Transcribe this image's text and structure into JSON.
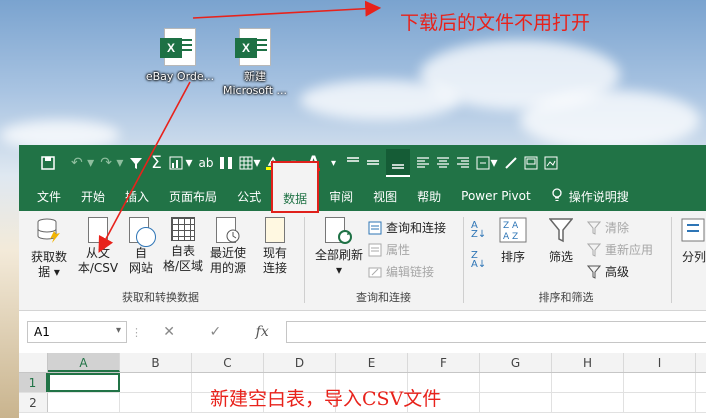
{
  "desktop": {
    "icons": [
      {
        "label": "eBay Orde...",
        "icon": "excel-file-icon",
        "badge": "X"
      },
      {
        "label": "新建",
        "label2": "Microsoft ...",
        "icon": "excel-file-icon",
        "badge": "X"
      }
    ]
  },
  "annotations": {
    "top": "下载后的文件不用打开",
    "bottom": "新建空白表，导入CSV文件",
    "color": "#e8221b"
  },
  "quick_access": {
    "icons": [
      "save-icon",
      "undo-icon",
      "redo-icon",
      "filter-icon",
      "autosum-icon",
      "chart-icon",
      "spelling-icon",
      "columns-icon",
      "table-icon",
      "fill-color-icon",
      "font-color-icon",
      "align-top-icon",
      "align-middle-icon",
      "align-bottom-icon",
      "align-left-icon",
      "align-center-icon",
      "align-right-icon",
      "merge-icon",
      "format-painter-icon",
      "view-icon",
      "view-icon-2"
    ],
    "spell_label": "ab",
    "font_color_label": "A"
  },
  "tabs": [
    "文件",
    "开始",
    "插入",
    "页面布局",
    "公式",
    "数据",
    "审阅",
    "视图",
    "帮助",
    "Power Pivot",
    "操作说明搜"
  ],
  "active_tab": "数据",
  "ribbon": {
    "get_transform": {
      "label": "获取和转换数据",
      "buttons": [
        {
          "line1": "获取数",
          "line2": "据 ▾"
        },
        {
          "line1": "从文",
          "line2": "本/CSV"
        },
        {
          "line1": "自",
          "line2": "网站"
        },
        {
          "line1": "自表",
          "line2": "格/区域"
        },
        {
          "line1": "最近使",
          "line2": "用的源"
        },
        {
          "line1": "现有",
          "line2": "连接"
        }
      ]
    },
    "queries": {
      "label": "查询和连接",
      "refresh_all": "全部刷新",
      "refresh_arrow": "▾",
      "items": [
        "查询和连接",
        "属性",
        "编辑链接"
      ]
    },
    "sort_filter": {
      "label": "排序和筛选",
      "sort": "排序",
      "filter": "筛选",
      "items": [
        "清除",
        "重新应用",
        "高级"
      ]
    },
    "more": "分列"
  },
  "formula_bar": {
    "name_box": "A1",
    "cancel": "✕",
    "enter": "✓",
    "fx": "fx",
    "formula": ""
  },
  "sheet": {
    "columns": [
      "A",
      "B",
      "C",
      "D",
      "E",
      "F",
      "G",
      "H",
      "I"
    ],
    "rows": [
      "1",
      "2"
    ],
    "selected": "A1"
  }
}
